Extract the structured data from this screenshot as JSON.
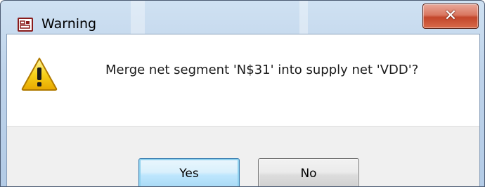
{
  "window": {
    "title": "Warning",
    "close_icon": "close-icon"
  },
  "dialog": {
    "icon": "warning-icon",
    "message": "Merge net segment 'N$31' into supply net 'VDD'?"
  },
  "buttons": {
    "yes_label": "Yes",
    "no_label": "No"
  },
  "colors": {
    "close_button": "#c3462b",
    "default_button_border": "#3c7fb1",
    "warning_yellow": "#f5c400"
  }
}
